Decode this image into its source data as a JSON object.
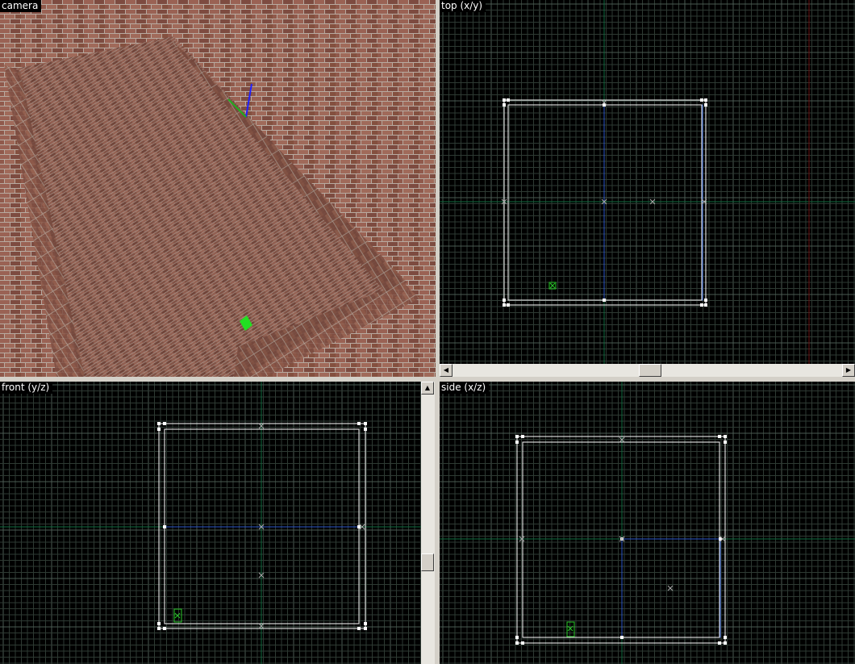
{
  "viewports": {
    "camera": {
      "label": "camera"
    },
    "top": {
      "label": "top (x/y)"
    },
    "front": {
      "label": "front (y/z)"
    },
    "side": {
      "label": "side (x/z)"
    }
  },
  "scrollbars": {
    "left_arrow": "◀",
    "right_arrow": "▶",
    "up_arrow": "▲"
  },
  "colors": {
    "grid_minor": "#2e3a33",
    "grid_major": "#4a5a52",
    "axis": "#0e6a3e",
    "red_line": "#6a1010",
    "brush_white": "#ffffff",
    "brush_blue": "#2a55c8",
    "entity_green": "#29c829"
  }
}
